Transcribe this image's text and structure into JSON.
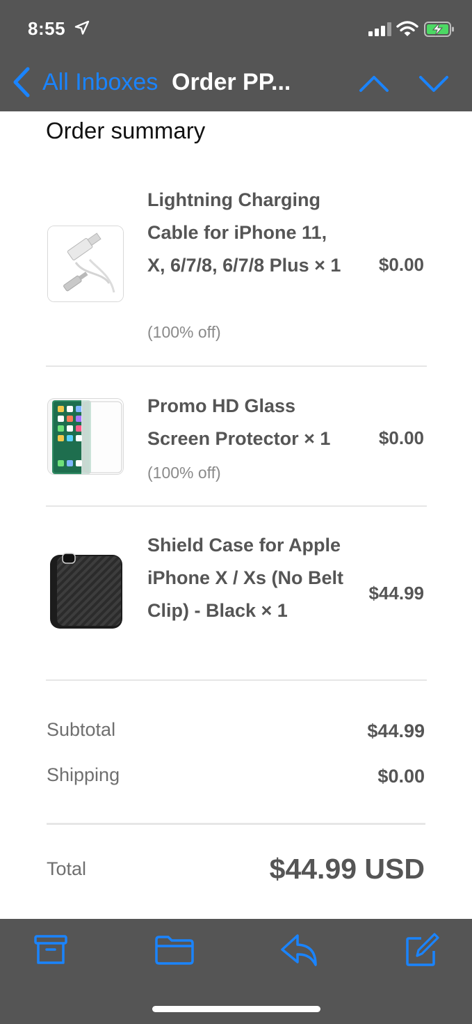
{
  "status_bar": {
    "time": "8:55",
    "icons": [
      "location-arrow-icon",
      "cellular-signal-icon",
      "wifi-icon",
      "battery-charging-icon"
    ]
  },
  "nav": {
    "back_label": "All Inboxes",
    "title": "Order PP...",
    "icons": [
      "chevron-left-icon",
      "chevron-up-icon",
      "chevron-down-icon"
    ]
  },
  "order": {
    "section_title": "Order summary",
    "items": [
      {
        "name": "Lightning Charging Cable for iPhone 11, X, 6/7/8, 6/7/8 Plus × 1",
        "discount": "(100% off)",
        "price": "$0.00",
        "image": "lightning-cable-image"
      },
      {
        "name": "Promo HD Glass Screen Protector × 1",
        "discount": "(100% off)",
        "price": "$0.00",
        "image": "screen-protector-image"
      },
      {
        "name": "Shield Case for Apple iPhone X / Xs (No Belt Clip) - Black × 1",
        "discount": "",
        "price": "$44.99",
        "image": "phone-case-image"
      }
    ],
    "subtotal_label": "Subtotal",
    "subtotal_value": "$44.99",
    "shipping_label": "Shipping",
    "shipping_value": "$0.00",
    "total_label": "Total",
    "total_value": "$44.99 USD"
  },
  "toolbar": {
    "icons": [
      "archive-icon",
      "folder-icon",
      "reply-icon",
      "compose-icon"
    ]
  },
  "colors": {
    "bar_background": "#555555",
    "accent": "#1a84ff",
    "text": "#555555",
    "muted_text": "#8a8a8a"
  }
}
